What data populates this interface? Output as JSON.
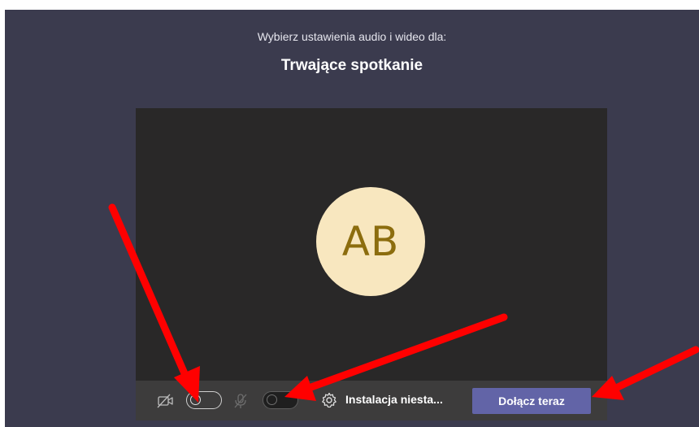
{
  "prejoin": {
    "subtitle": "Wybierz ustawienia audio i wideo dla:",
    "meeting_title": "Trwające spotkanie"
  },
  "preview": {
    "avatar_initials": "AB",
    "avatar_bg_color": "#f8e7bf",
    "avatar_text_color": "#8c6d0e"
  },
  "controls": {
    "camera_icon": "camera-off-icon",
    "camera_toggle_state": "off",
    "mic_icon": "mic-off-icon",
    "mic_toggle_state": "off",
    "settings_icon": "gear-icon",
    "device_settings_label": "Instalacja niesta...",
    "join_button_label": "Dołącz teraz",
    "join_button_color": "#6264a7"
  },
  "colors": {
    "page_bg": "#3b3b4e",
    "annotation_arrow": "#ff0000"
  }
}
